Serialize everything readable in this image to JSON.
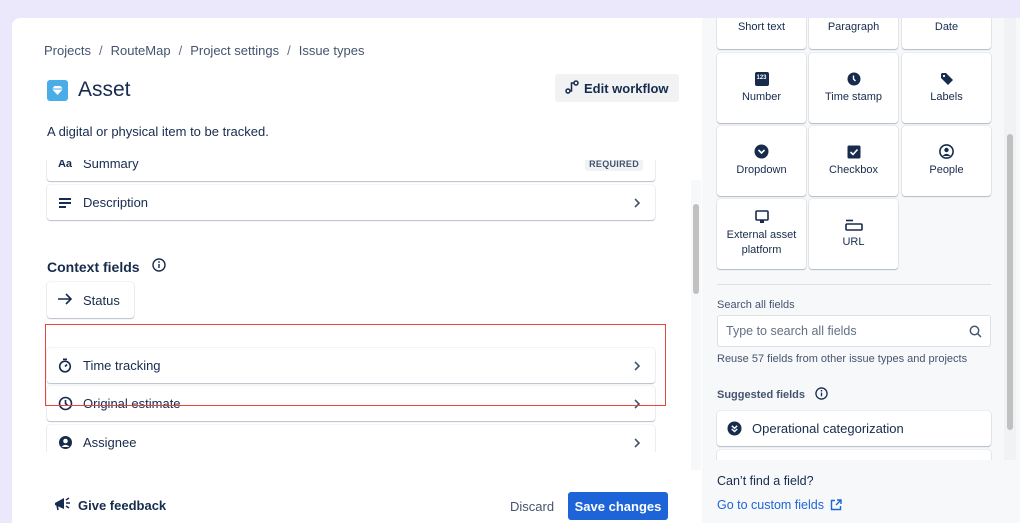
{
  "breadcrumb": [
    "Projects",
    "RouteMap",
    "Project settings",
    "Issue types"
  ],
  "breadcrumb_separator": "/",
  "header": {
    "title": "Asset",
    "issue_icon": "gem-icon",
    "issue_icon_color": "#4bade8",
    "edit_workflow_label": "Edit workflow",
    "description": "A digital or physical item to be tracked."
  },
  "fields": [
    {
      "label": "Summary",
      "icon": "text-aa-icon",
      "badge": "REQUIRED"
    },
    {
      "label": "Description",
      "icon": "description-lines-icon"
    }
  ],
  "context": {
    "title": "Context fields",
    "status_label": "Status",
    "fields": [
      {
        "label": "Time tracking",
        "icon": "stopwatch-icon"
      },
      {
        "label": "Original estimate",
        "icon": "clock-icon"
      },
      {
        "label": "Assignee",
        "icon": "person-circle-icon"
      }
    ],
    "highlight_color": "#e2483d"
  },
  "footer": {
    "feedback_label": "Give feedback",
    "discard_label": "Discard",
    "save_label": "Save changes",
    "save_color": "#1d64d8"
  },
  "side": {
    "field_types": [
      {
        "label": "Short text",
        "icon": "short-text-icon"
      },
      {
        "label": "Paragraph",
        "icon": "paragraph-icon"
      },
      {
        "label": "Date",
        "icon": "calendar-icon"
      },
      {
        "label": "Number",
        "icon": "number-123-icon"
      },
      {
        "label": "Time stamp",
        "icon": "clock-filled-icon"
      },
      {
        "label": "Labels",
        "icon": "tag-icon"
      },
      {
        "label": "Dropdown",
        "icon": "dropdown-circle-icon"
      },
      {
        "label": "Checkbox",
        "icon": "checkbox-icon"
      },
      {
        "label": "People",
        "icon": "person-circle-icon"
      },
      {
        "label": "External asset platform",
        "icon": "monitor-icon"
      },
      {
        "label": "URL",
        "icon": "url-field-icon"
      }
    ],
    "search_label": "Search all fields",
    "search_placeholder": "Type to search all fields",
    "search_value": "",
    "reuse_text": "Reuse 57 fields from other issue types and projects",
    "suggested_title": "Suggested fields",
    "suggested": [
      {
        "label": "Operational categorization",
        "icon": "chevron-double-circle-icon"
      }
    ],
    "cant_find": "Can’t find a field?",
    "custom_fields_link": "Go to custom fields"
  }
}
